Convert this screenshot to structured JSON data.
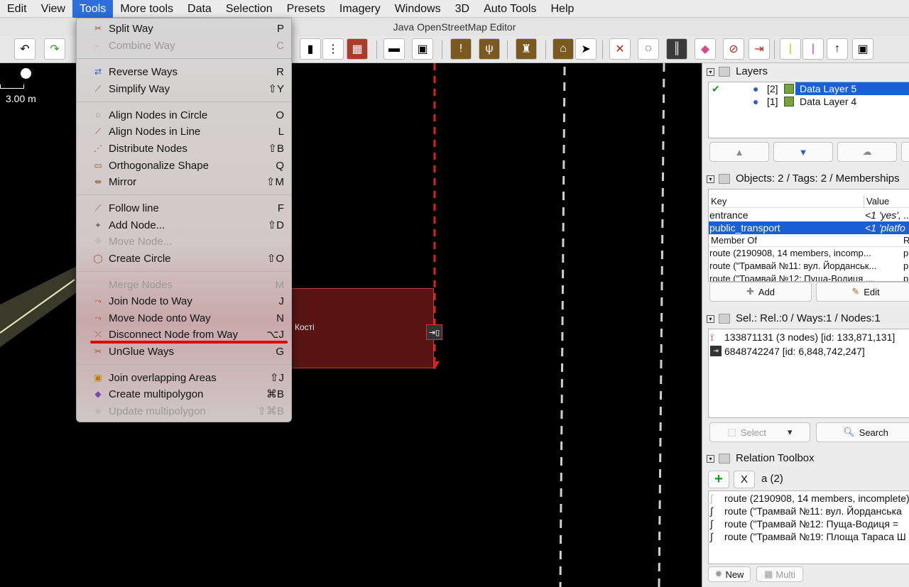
{
  "menubar": [
    "Edit",
    "View",
    "Tools",
    "More tools",
    "Data",
    "Selection",
    "Presets",
    "Imagery",
    "Windows",
    "3D",
    "Auto Tools",
    "Help"
  ],
  "window_title": "Java OpenStreetMap Editor",
  "scale_label": "3.00 m",
  "area_label": "Кості",
  "tools_menu": {
    "items": [
      {
        "label": "Split Way",
        "shortcut": "P"
      },
      {
        "label": "Combine Way",
        "shortcut": "C"
      },
      {
        "label": "Reverse Ways",
        "shortcut": "R"
      },
      {
        "label": "Simplify Way",
        "shortcut": "⇧Y"
      },
      {
        "label": "Align Nodes in Circle",
        "shortcut": "O"
      },
      {
        "label": "Align Nodes in Line",
        "shortcut": "L"
      },
      {
        "label": "Distribute Nodes",
        "shortcut": "⇧B"
      },
      {
        "label": "Orthogonalize Shape",
        "shortcut": "Q"
      },
      {
        "label": "Mirror",
        "shortcut": "⇧M"
      },
      {
        "label": "Follow line",
        "shortcut": "F"
      },
      {
        "label": "Add Node...",
        "shortcut": "⇧D"
      },
      {
        "label": "Move Node...",
        "shortcut": ""
      },
      {
        "label": "Create Circle",
        "shortcut": "⇧O"
      },
      {
        "label": "Merge Nodes",
        "shortcut": "M"
      },
      {
        "label": "Join Node to Way",
        "shortcut": "J"
      },
      {
        "label": "Move Node onto Way",
        "shortcut": "N"
      },
      {
        "label": "Disconnect Node from Way",
        "shortcut": "⌥J"
      },
      {
        "label": "UnGlue Ways",
        "shortcut": "G"
      },
      {
        "label": "Join overlapping Areas",
        "shortcut": "⇧J"
      },
      {
        "label": "Create multipolygon",
        "shortcut": "⌘B"
      },
      {
        "label": "Update multipolygon",
        "shortcut": "⇧⌘B"
      }
    ]
  },
  "layers": {
    "title": "Layers",
    "items": [
      {
        "index": "[2]",
        "name": "Data Layer 5"
      },
      {
        "index": "[1]",
        "name": "Data Layer 4"
      }
    ]
  },
  "objects": {
    "title": "Objects: 2 / Tags: 2 / Memberships",
    "col_key": "Key",
    "col_value": "Value",
    "tags": [
      {
        "key": "entrance",
        "value": "<1 'yes', ..."
      },
      {
        "key": "public_transport",
        "value": "<1 'platfo"
      }
    ],
    "member_of_header": "Member Of",
    "member_role_header": "Ro",
    "memberships": [
      {
        "name": "route (2190908, 14 members, incomp...",
        "role": "pl"
      },
      {
        "name": "route (\"Трамвай №11: вул. Йорданськ...",
        "role": "pl"
      },
      {
        "name": "route (\"Трамвай №12: Пуща-Водиця ...",
        "role": "pl"
      }
    ],
    "add_label": "Add",
    "edit_label": "Edit"
  },
  "selection": {
    "title": "Sel.: Rel.:0 / Ways:1 / Nodes:1",
    "items": [
      "133871131 (3 nodes) [id: 133,871,131]",
      "6848742247 [id: 6,848,742,247]"
    ],
    "select_label": "Select",
    "search_label": "Search"
  },
  "relation_toolbox": {
    "title": "Relation Toolbox",
    "add_symbol": "+",
    "remove_symbol": "X",
    "role_value": "a (2)",
    "items": [
      "route (2190908, 14 members, incomplete)",
      "route (\"Трамвай №11: вул. Йорданська",
      "route (\"Трамвай №12: Пуща-Водиця =",
      "route (\"Трамвай №19: Площа Тараса Ш"
    ],
    "new_label": "New",
    "multi_label": "Multi"
  },
  "colors": {
    "selection_blue": "#1a5fd6",
    "highlight_red": "#e00000",
    "area_fill": "#5a1414"
  }
}
